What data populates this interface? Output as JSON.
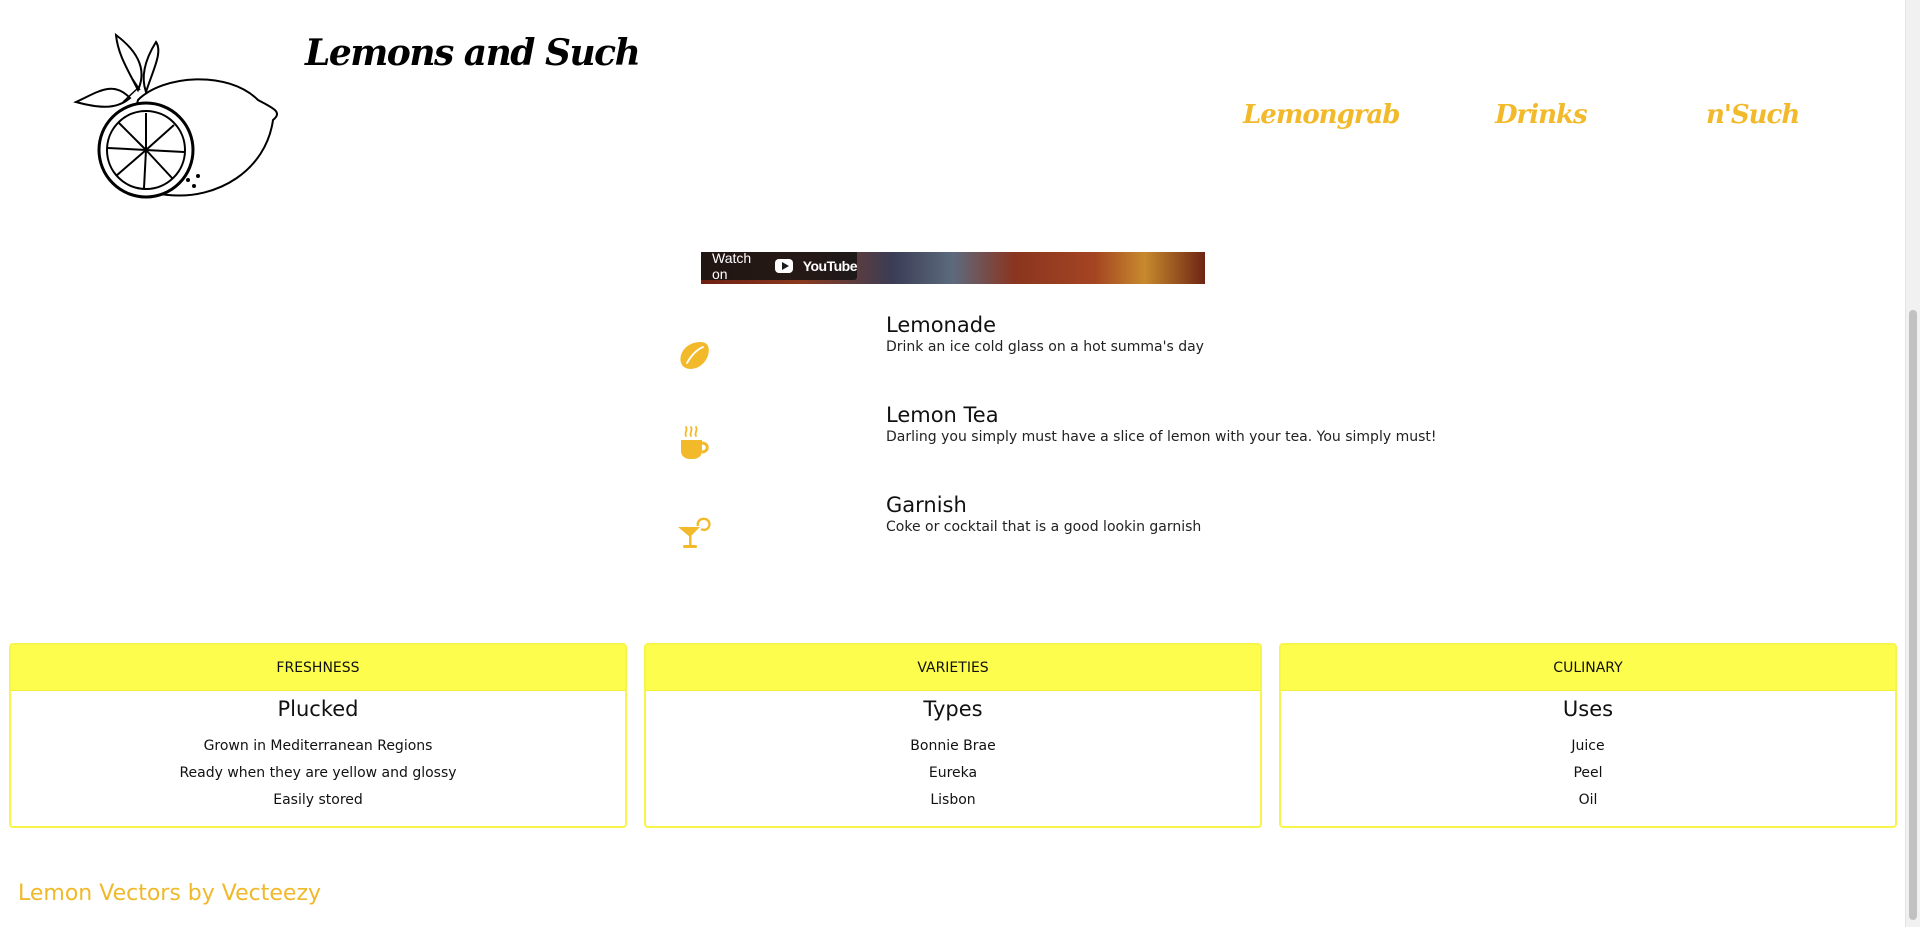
{
  "header": {
    "site_title": "Lemons and Such",
    "nav": [
      {
        "label": "Lemongrab"
      },
      {
        "label": "Drinks"
      },
      {
        "label": "n'Such"
      }
    ]
  },
  "video": {
    "watch_on": "Watch on",
    "brand": "YouTube"
  },
  "features": [
    {
      "icon": "lemon-icon",
      "title": "Lemonade",
      "description": "Drink an ice cold glass on a hot summa's day"
    },
    {
      "icon": "mug-icon",
      "title": "Lemon Tea",
      "description": "Darling you simply must have a slice of lemon with your tea. You simply must!"
    },
    {
      "icon": "cocktail-icon",
      "title": "Garnish",
      "description": "Coke or cocktail that is a good lookin garnish"
    }
  ],
  "cards": [
    {
      "header": "FRESHNESS",
      "title": "Plucked",
      "items": [
        "Grown in Mediterranean Regions",
        "Ready when they are yellow and glossy",
        "Easily stored"
      ]
    },
    {
      "header": "VARIETIES",
      "title": "Types",
      "items": [
        "Bonnie Brae",
        "Eureka",
        "Lisbon"
      ]
    },
    {
      "header": "CULINARY",
      "title": "Uses",
      "items": [
        "Juice",
        "Peel",
        "Oil"
      ]
    }
  ],
  "footer": {
    "credit": "Lemon Vectors by Vecteezy"
  },
  "colors": {
    "accent": "#f2b92b",
    "card_header": "#fdfd4d",
    "card_border": "#f8f54a"
  }
}
